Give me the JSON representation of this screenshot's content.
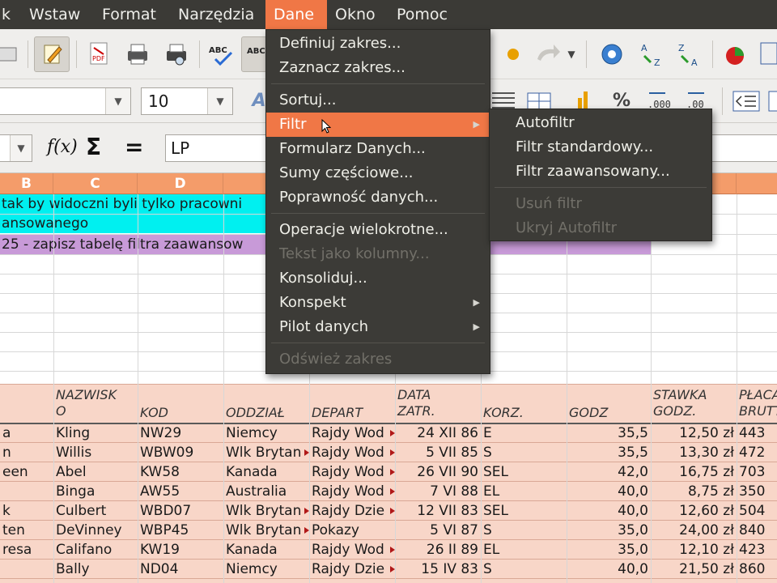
{
  "menubar": {
    "items": [
      {
        "label": "k"
      },
      {
        "label": "Wstaw"
      },
      {
        "label": "Format"
      },
      {
        "label": "Narzędzia"
      },
      {
        "label": "Dane"
      },
      {
        "label": "Okno"
      },
      {
        "label": "Pomoc"
      }
    ]
  },
  "toolbar": {
    "font_size": "10",
    "percent": "%"
  },
  "formula": {
    "fx": "f(x)",
    "sum": "Σ",
    "eq": "=",
    "value": "LP"
  },
  "columns": [
    "B",
    "C",
    "D"
  ],
  "rows": {
    "task1": "tak by widoczni byli tylko pracowni",
    "task2": "ansowanego",
    "task3": "25 - zapisz tabelę filtra zaawansow"
  },
  "table": {
    "headers": [
      "NAZWISK\nO",
      "KOD",
      "ODDZIAŁ",
      "DEPART",
      "DATA\nZATR.",
      "KORZ.",
      "GODZ",
      "STAWKA\nGODZ.",
      "PŁACA\nBRUTT"
    ],
    "rows": [
      [
        "a",
        "Kling",
        "NW29",
        "Niemcy",
        "Rajdy Wod",
        "24 XII 86",
        "E",
        "35,5",
        "12,50 zł",
        "443"
      ],
      [
        "n",
        "Willis",
        "WBW09",
        "Wlk Brytan",
        "Rajdy Wod",
        "5 VII 85",
        "S",
        "35,5",
        "13,30 zł",
        "472"
      ],
      [
        "een",
        "Abel",
        "KW58",
        "Kanada",
        "Rajdy Wod",
        "26 VII 90",
        "SEL",
        "42,0",
        "16,75 zł",
        "703"
      ],
      [
        "",
        "Binga",
        "AW55",
        "Australia",
        "Rajdy Wod",
        "7 VI 88",
        "EL",
        "40,0",
        "8,75 zł",
        "350"
      ],
      [
        "k",
        "Culbert",
        "WBD07",
        "Wlk Brytan",
        "Rajdy Dzie",
        "12 VII 83",
        "SEL",
        "40,0",
        "12,60 zł",
        "504"
      ],
      [
        "ten",
        "DeVinney",
        "WBP45",
        "Wlk Brytan",
        "Pokazy",
        "5 VI 87",
        "S",
        "35,0",
        "24,00 zł",
        "840"
      ],
      [
        "resa",
        "Califano",
        "KW19",
        "Kanada",
        "Rajdy Wod",
        "26 II 89",
        "EL",
        "35,0",
        "12,10 zł",
        "423"
      ],
      [
        "",
        "Bally",
        "ND04",
        "Niemcy",
        "Rajdy Dzie",
        "15 IV 83",
        "S",
        "40,0",
        "21,50 zł",
        "860"
      ]
    ]
  },
  "dane_menu": {
    "items": [
      {
        "label": "Definiuj zakres...",
        "disabled": false,
        "submenu": false
      },
      {
        "label": "Zaznacz zakres...",
        "disabled": false,
        "submenu": false
      },
      {
        "label": "Sortuj...",
        "disabled": false,
        "submenu": false
      },
      {
        "label": "Filtr",
        "disabled": false,
        "submenu": true
      },
      {
        "label": "Formularz Danych...",
        "disabled": false,
        "submenu": false
      },
      {
        "label": "Sumy częściowe...",
        "disabled": false,
        "submenu": false
      },
      {
        "label": "Poprawność danych...",
        "disabled": false,
        "submenu": false
      },
      {
        "label": "Operacje wielokrotne...",
        "disabled": false,
        "submenu": false
      },
      {
        "label": "Tekst jako kolumny...",
        "disabled": true,
        "submenu": false
      },
      {
        "label": "Konsoliduj...",
        "disabled": false,
        "submenu": false
      },
      {
        "label": "Konspekt",
        "disabled": false,
        "submenu": true
      },
      {
        "label": "Pilot danych",
        "disabled": false,
        "submenu": true
      },
      {
        "label": "Odśwież zakres",
        "disabled": true,
        "submenu": false
      }
    ]
  },
  "filtr_menu": {
    "items": [
      {
        "label": "Autofiltr",
        "disabled": false
      },
      {
        "label": "Filtr standardowy...",
        "disabled": false
      },
      {
        "label": "Filtr zaawansowany...",
        "disabled": false
      },
      {
        "label": "Usuń filtr",
        "disabled": true
      },
      {
        "label": "Ukryj Autofiltr",
        "disabled": true
      }
    ]
  },
  "colors": {
    "menubar_bg": "#3b3a36",
    "accent": "#f07746",
    "cyan": "#00f0f0",
    "purple": "#c89ad8",
    "salmon": "#f8d6c8"
  }
}
